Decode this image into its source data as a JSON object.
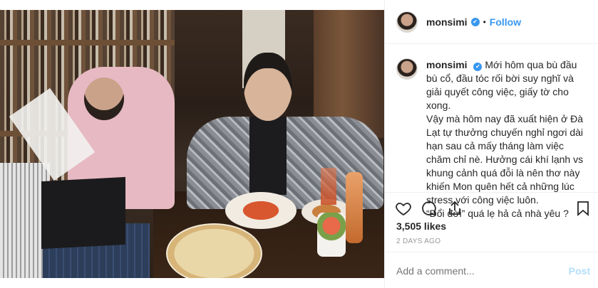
{
  "post": {
    "username": "monsimi",
    "verified_mark": "✔",
    "dot": "•",
    "follow_label": "Follow",
    "caption_username": "monsimi",
    "caption_text": "Mới hôm qua bù đầu bù cổ, đầu tóc rối bời suy nghĩ và giải quyết công việc, giấy tờ cho xong.\nVậy mà hôm nay đã xuất hiện ở Đà Lạt tự thưởng chuyến nghỉ ngơi dài hạn sau cả mấy tháng làm việc chăm chỉ nè. Hưởng cái khí lạnh vs khung cảnh quá đỗi là nên thơ này khiến Mon quên hết cả những lúc stress với công việc luôn.\n“Đổi đời” quá lẹ hả cả nhà yêu ?",
    "likes": "3,505 likes",
    "time_ago": "2 DAYS AGO",
    "comment_placeholder": "Add a comment...",
    "post_label": "Post"
  },
  "icons": {
    "like": "heart-icon",
    "comment": "comment-icon",
    "share": "share-icon",
    "save": "bookmark-icon"
  },
  "colors": {
    "accent": "#3897f0",
    "post_disabled": "#b2dffc",
    "text": "#262626",
    "muted": "#999999"
  }
}
